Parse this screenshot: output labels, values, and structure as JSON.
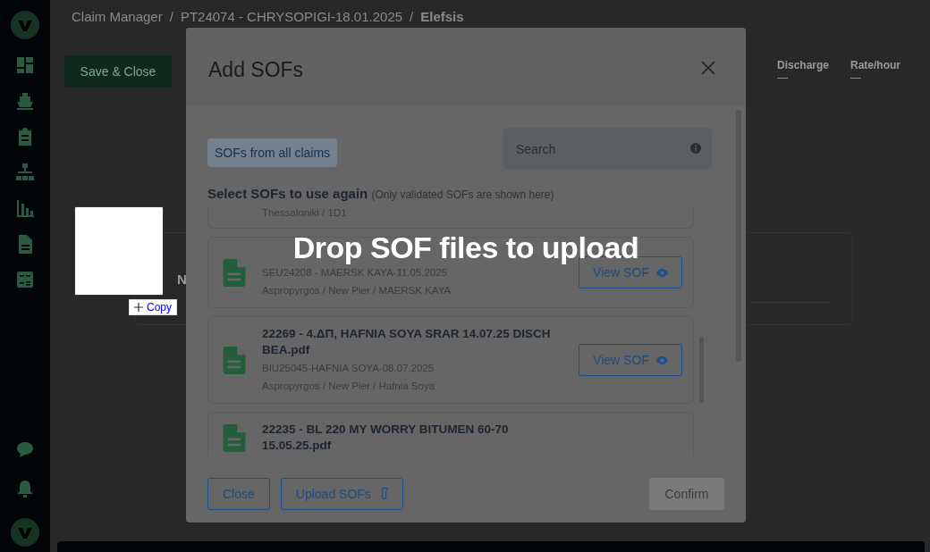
{
  "breadcrumb": {
    "separator": "/",
    "items": [
      "Claim Manager",
      "PT24074 - CHRYSOPIGI-18.01.2025",
      "Elefsis"
    ]
  },
  "save_button": "Save & Close",
  "summary": [
    {
      "label": "Discharge",
      "value": "—"
    },
    {
      "label": "Rate/hour",
      "value": "—"
    }
  ],
  "card_label": "N",
  "drag_ghost": {
    "label": "Copy"
  },
  "modal": {
    "title": "Add SOFs",
    "filter_chip": "SOFs from all claims",
    "search": {
      "placeholder": "Search"
    },
    "section_title": "Select SOFs to use again",
    "section_note": "(Only validated SOFs are shown here)",
    "items": [
      {
        "location": "Thessaloniki / 1D1"
      },
      {
        "reference": "SEU24208 - MAERSK KAYA-11.05.2025",
        "location": "Aspropyrgos / New Pier / MAERSK KAYA",
        "view_label": "View SOF"
      },
      {
        "title": "22269 - 4.ΔΠ, HAFNIA SOYA SRAR 14.07.25 DISCH BEA.pdf",
        "reference": "BIU25045-HAFNIA SOYA-08.07.2025",
        "location": "Aspropyrgos / New Pier / Hafnia Soya",
        "view_label": "View SOF"
      },
      {
        "title": "22235 - BL 220 MY WORRY BITUMEN 60-70 15.05.25.pdf"
      }
    ],
    "drop_message": "Drop SOF files to upload",
    "footer": [
      {
        "label": "Close",
        "kind": "outline"
      },
      {
        "label": "Upload SOFs",
        "kind": "upload"
      },
      {
        "label": "Confirm",
        "kind": "primary",
        "disabled": true
      }
    ]
  }
}
